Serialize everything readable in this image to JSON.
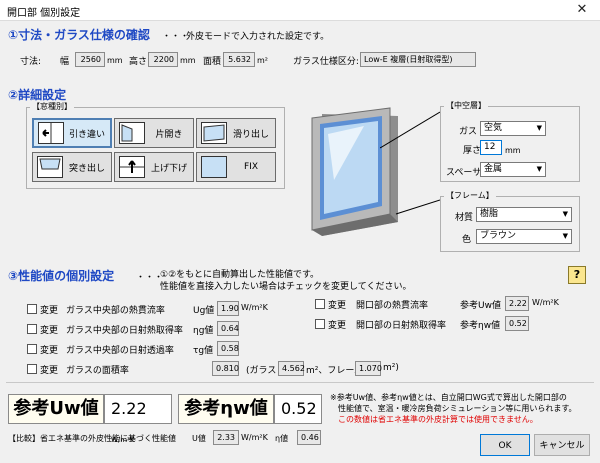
{
  "window": {
    "title": "開口部 個別設定",
    "close_glyph": "✕"
  },
  "sec1": {
    "heading": "①寸法・ガラス仕様の確認",
    "dots": "・・・",
    "note": "外皮モードで入力された設定です。",
    "dims_label": "寸法:",
    "width_label": "幅",
    "width_value": "2560",
    "width_unit": "mm",
    "height_label": "高さ",
    "height_value": "2200",
    "height_unit": "mm",
    "area_label": "面積",
    "area_value": "5.632",
    "area_unit": "m²",
    "glass_label": "ガラス仕様区分:",
    "glass_value": "Low-E 複層(日射取得型)"
  },
  "sec2": {
    "heading": "②詳細設定",
    "window_type_legend": "【窓種別】",
    "window_types": [
      {
        "label": "引き違い"
      },
      {
        "label": "片開き"
      },
      {
        "label": "滑り出し"
      },
      {
        "label": "突き出し"
      },
      {
        "label": "上げ下げ"
      },
      {
        "label": "FIX"
      }
    ],
    "air_legend": "【中空層】",
    "gas_label": "ガス",
    "gas_value": "空気",
    "thickness_label": "厚さ",
    "thickness_value": "12",
    "thickness_unit": "mm",
    "spacer_label": "スペーサ",
    "spacer_value": "金属",
    "frame_legend": "【フレーム】",
    "material_label": "材質",
    "material_value": "樹脂",
    "color_label": "色",
    "color_value": "ブラウン"
  },
  "sec3": {
    "heading": "③性能値の個別設定",
    "dots": "・・・",
    "note1": "①②をもとに自動算出した性能値です。",
    "note2": "性能値を直接入力したい場合はチェックを変更してください。",
    "help": "?",
    "change": "変更",
    "rows_left": [
      {
        "text": "ガラス中央部の熱貫流率",
        "sym": "Ug値",
        "value": "1.90",
        "unit": "W/m²K"
      },
      {
        "text": "ガラス中央部の日射熱取得率",
        "sym": "ηg値",
        "value": "0.64",
        "unit": ""
      },
      {
        "text": "ガラス中央部の日射透過率",
        "sym": "τg値",
        "value": "0.58",
        "unit": ""
      },
      {
        "text": "ガラスの面積率",
        "sym": "",
        "value": "0.810",
        "unit": ""
      }
    ],
    "rows_right": [
      {
        "text": "開口部の熱貫流率",
        "sym": "参考Uw値",
        "value": "2.22",
        "unit": "W/m²K"
      },
      {
        "text": "開口部の日射熱取得率",
        "sym": "参考ηw値",
        "value": "0.52",
        "unit": ""
      }
    ],
    "area_glass_prefix": "(ガラス",
    "area_glass_value": "4.562",
    "area_frame_prefix": "m²、フレーム",
    "area_frame_value": "1.070",
    "area_suffix": "m²)"
  },
  "bottom": {
    "uw_label": "参考Uw値",
    "uw_value": "2.22",
    "uw_unit": "W/m²K",
    "eta_label": "参考ηw値",
    "eta_value": "0.52",
    "note1": "※参考Uw値、参考ηw値とは、自立開口WG式で算出した開口部の",
    "note2": "性能値で、室温・暖冷房負荷シミュレーション等に用いられます。",
    "note3": "この数値は省エネ基準の外皮計算では使用できません。",
    "compare_label": "【比較】省エネ基準の外皮性能に基づく性能値",
    "cmp_u_label": "U値",
    "cmp_u_value": "2.33",
    "cmp_u_unit": "W/m²K",
    "cmp_eta_label": "η値",
    "cmp_eta_value": "0.46",
    "ok": "OK",
    "cancel": "キャンセル"
  }
}
